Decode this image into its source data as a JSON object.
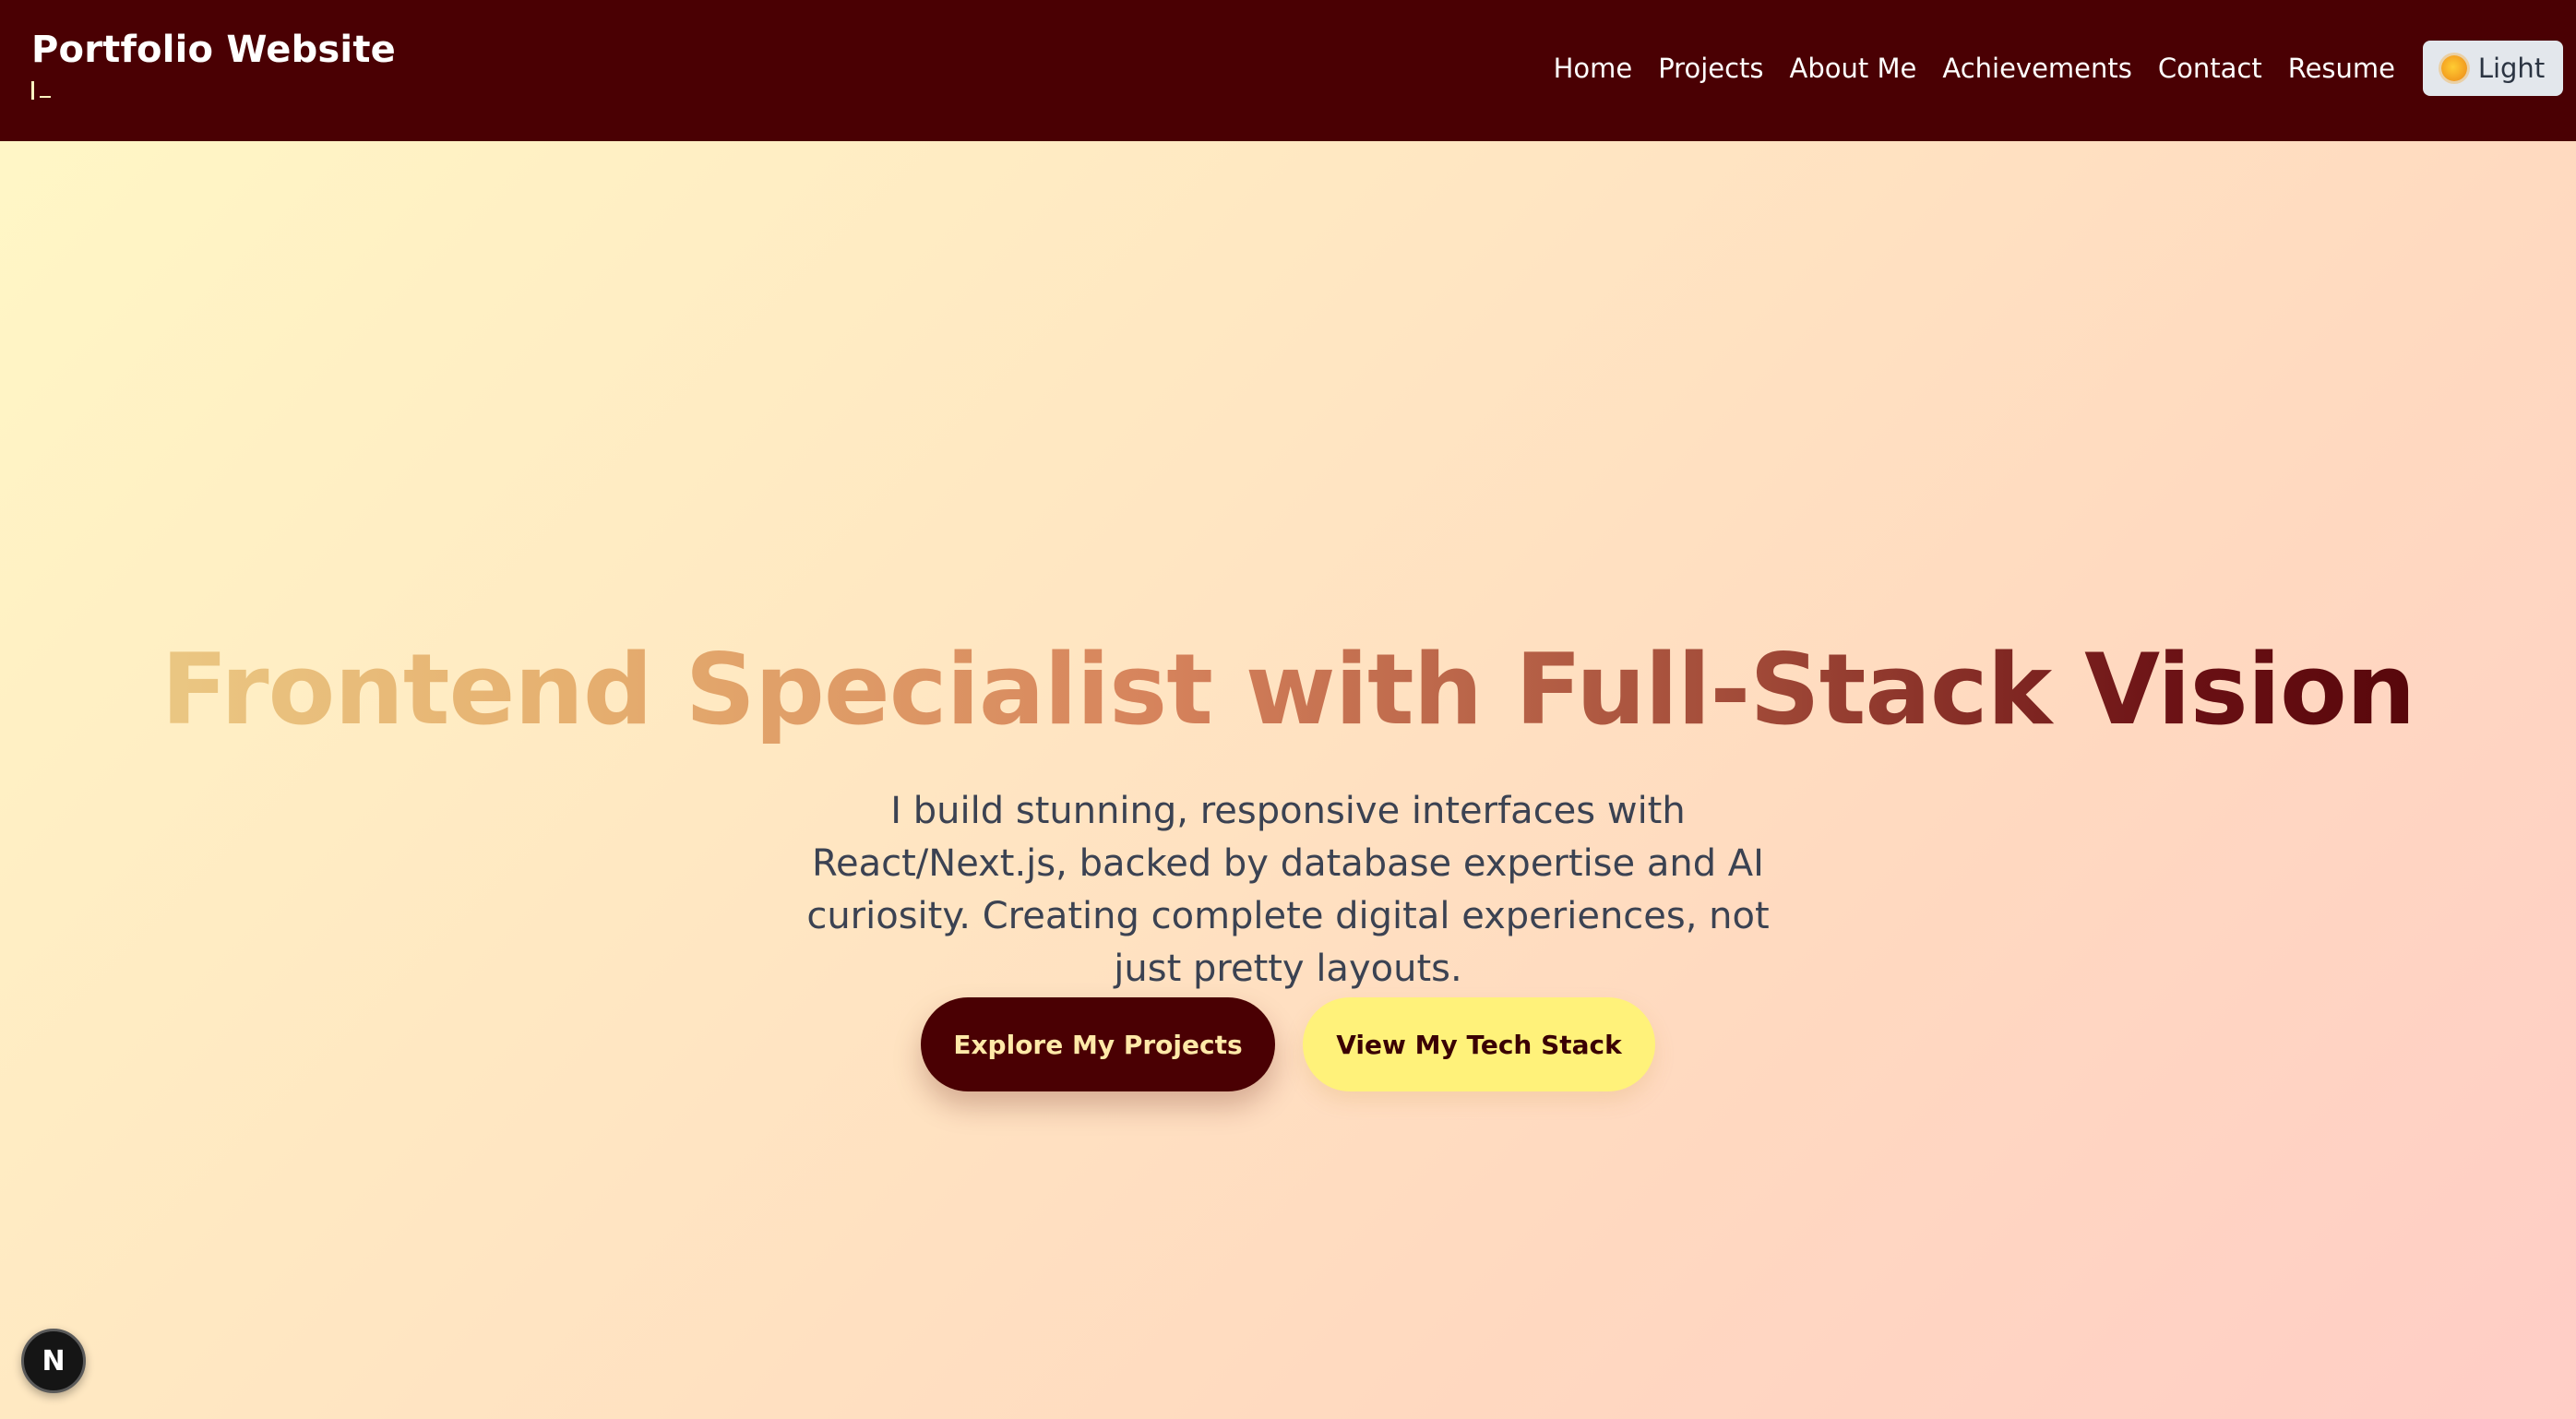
{
  "header": {
    "brand_title": "Portfolio Website",
    "nav": [
      "Home",
      "Projects",
      "About Me",
      "Achievements",
      "Contact",
      "Resume"
    ],
    "theme_toggle": {
      "icon": "sun-icon",
      "label": "Light"
    }
  },
  "hero": {
    "headline": "Frontend Specialist with Full-Stack Vision",
    "subtext": "I build stunning, responsive interfaces with React/Next.js, backed by database expertise and AI curiosity. Creating complete digital experiences, not just pretty layouts.",
    "primary_cta": "Explore My Projects",
    "secondary_cta": "View My Tech Stack"
  },
  "dev_badge": {
    "letter": "N",
    "icon": "nextjs-icon"
  },
  "colors": {
    "header_bg": "#4a0003",
    "primary_button": "#4a0003",
    "secondary_button": "#fff27a",
    "headline_gradient": [
      "#ecd08a",
      "#d6835c",
      "#4a0004"
    ]
  }
}
